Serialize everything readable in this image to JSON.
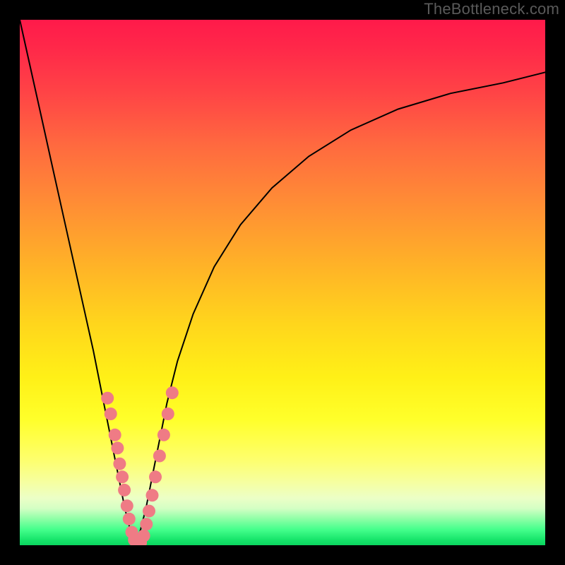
{
  "watermark": "TheBottleneck.com",
  "colors": {
    "frame": "#000000",
    "gradient_top": "#ff1a4a",
    "gradient_mid": "#ffe81a",
    "gradient_bottom": "#0bd45f",
    "curve": "#000000",
    "beads": "#ef7b85"
  },
  "chart_data": {
    "type": "line",
    "title": "",
    "xlabel": "",
    "ylabel": "",
    "xlim": [
      0,
      100
    ],
    "ylim": [
      0,
      100
    ],
    "grid": false,
    "legend": false,
    "series": [
      {
        "name": "left-curve",
        "x": [
          0,
          2,
          4,
          6,
          8,
          10,
          12,
          14,
          16,
          17,
          18,
          19,
          20,
          21,
          22
        ],
        "y": [
          100,
          91,
          82,
          73,
          64,
          55,
          46,
          37,
          27,
          22,
          17,
          12,
          7,
          3,
          0
        ]
      },
      {
        "name": "right-curve",
        "x": [
          22,
          23,
          24,
          25,
          26,
          27,
          28,
          30,
          33,
          37,
          42,
          48,
          55,
          63,
          72,
          82,
          92,
          100
        ],
        "y": [
          0,
          3,
          7,
          12,
          17,
          22,
          27,
          35,
          44,
          53,
          61,
          68,
          74,
          79,
          83,
          86,
          88,
          90
        ]
      }
    ],
    "highlight_points": {
      "name": "beads",
      "color": "#ef7b85",
      "points": [
        {
          "x": 16.7,
          "y": 28
        },
        {
          "x": 17.3,
          "y": 25
        },
        {
          "x": 18.1,
          "y": 21
        },
        {
          "x": 18.6,
          "y": 18.5
        },
        {
          "x": 19.0,
          "y": 15.5
        },
        {
          "x": 19.5,
          "y": 13
        },
        {
          "x": 19.9,
          "y": 10.5
        },
        {
          "x": 20.4,
          "y": 7.5
        },
        {
          "x": 20.8,
          "y": 5
        },
        {
          "x": 21.3,
          "y": 2.5
        },
        {
          "x": 21.8,
          "y": 1
        },
        {
          "x": 22.4,
          "y": 0.2
        },
        {
          "x": 23.0,
          "y": 0.5
        },
        {
          "x": 23.6,
          "y": 1.8
        },
        {
          "x": 24.1,
          "y": 4
        },
        {
          "x": 24.6,
          "y": 6.5
        },
        {
          "x": 25.2,
          "y": 9.5
        },
        {
          "x": 25.8,
          "y": 13
        },
        {
          "x": 26.6,
          "y": 17
        },
        {
          "x": 27.4,
          "y": 21
        },
        {
          "x": 28.2,
          "y": 25
        },
        {
          "x": 29.0,
          "y": 29
        }
      ]
    }
  }
}
